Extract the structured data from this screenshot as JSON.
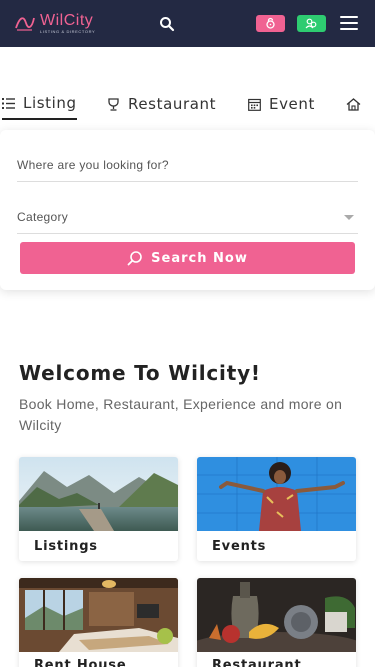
{
  "header": {
    "logo_text": "WilCity",
    "logo_tagline": "LISTING & DIRECTORY",
    "icons": [
      "search-icon",
      "login-icon",
      "register-icon",
      "menu-icon"
    ],
    "colors": {
      "bar": "#232943",
      "accent": "#f06292",
      "green": "#2ecc71"
    }
  },
  "tabs": [
    {
      "label": "Listing",
      "icon": "list-icon",
      "active": true
    },
    {
      "label": "Restaurant",
      "icon": "cup-icon",
      "active": false
    },
    {
      "label": "Event",
      "icon": "calendar-icon",
      "active": false
    },
    {
      "label": "",
      "icon": "home-icon",
      "active": false
    }
  ],
  "search": {
    "where_placeholder": "Where are you looking for?",
    "category_placeholder": "Category",
    "button_label": "Search Now"
  },
  "welcome": {
    "title": "Welcome To Wilcity!",
    "subtitle": "Book Home, Restaurant, Experience and more on Wilcity"
  },
  "cards": [
    {
      "label": "Listings"
    },
    {
      "label": "Events"
    },
    {
      "label": "Rent House"
    },
    {
      "label": "Restaurant"
    }
  ]
}
